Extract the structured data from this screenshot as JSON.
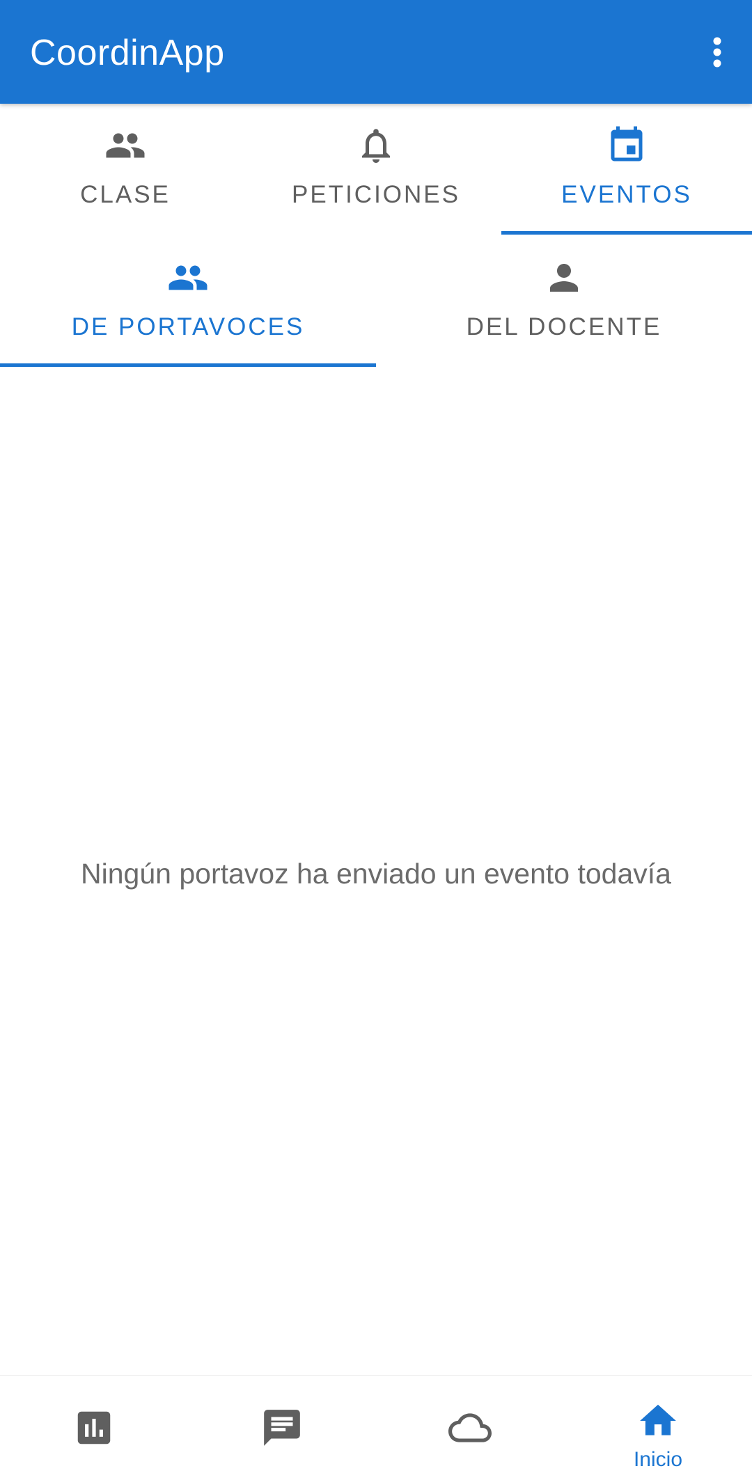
{
  "appbar": {
    "title": "CoordinApp",
    "menu_icon": "more-vert-icon"
  },
  "main_tabs": [
    {
      "label": "CLASE",
      "icon": "group-icon",
      "active": false
    },
    {
      "label": "PETICIONES",
      "icon": "bell-icon",
      "active": false
    },
    {
      "label": "EVENTOS",
      "icon": "calendar-icon",
      "active": true
    }
  ],
  "sub_tabs": [
    {
      "label": "DE PORTAVOCES",
      "icon": "group-icon",
      "active": true
    },
    {
      "label": "DEL DOCENTE",
      "icon": "person-icon",
      "active": false
    }
  ],
  "content": {
    "empty_message": "Ningún portavoz ha enviado un evento todavía"
  },
  "bottom_nav": [
    {
      "icon": "bar-chart-icon",
      "label": "",
      "active": false
    },
    {
      "icon": "chat-icon",
      "label": "",
      "active": false
    },
    {
      "icon": "cloud-icon",
      "label": "",
      "active": false
    },
    {
      "icon": "home-icon",
      "label": "Inicio",
      "active": true
    }
  ],
  "colors": {
    "primary": "#1b75d1",
    "inactive": "#5f5f5f",
    "text_muted": "#6b6b6b"
  }
}
